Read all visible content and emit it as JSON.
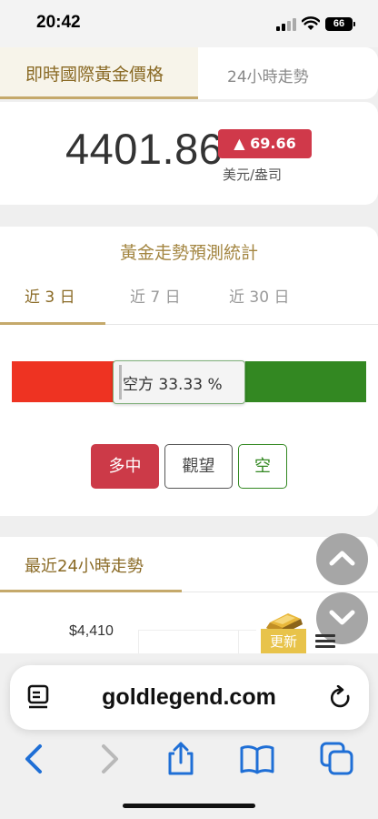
{
  "status_bar": {
    "time": "20:42",
    "battery": "66"
  },
  "tabs": {
    "active": "即時國際黃金價格",
    "other": "24小時走勢"
  },
  "price": {
    "value": "4401.86",
    "change": "▲ 69.66",
    "unit": "美元/盎司"
  },
  "forecast": {
    "title": "黃金走勢預測統計",
    "periods": [
      "近 3 日",
      "近 7 日",
      "近 30 日"
    ],
    "active_period": "近 3 日",
    "tooltip": "空方 33.33 %",
    "bear_percent": 33.33,
    "buttons": {
      "long": "多中",
      "wait": "觀望",
      "short": "空"
    },
    "colors": {
      "long": "#ee3322",
      "neutral": "#d6d6d6",
      "short": "#338822"
    }
  },
  "trend": {
    "title": "最近24小時走勢",
    "y_label": "$4,410",
    "update_label": "更新"
  },
  "browser": {
    "url": "goldlegend.com"
  }
}
